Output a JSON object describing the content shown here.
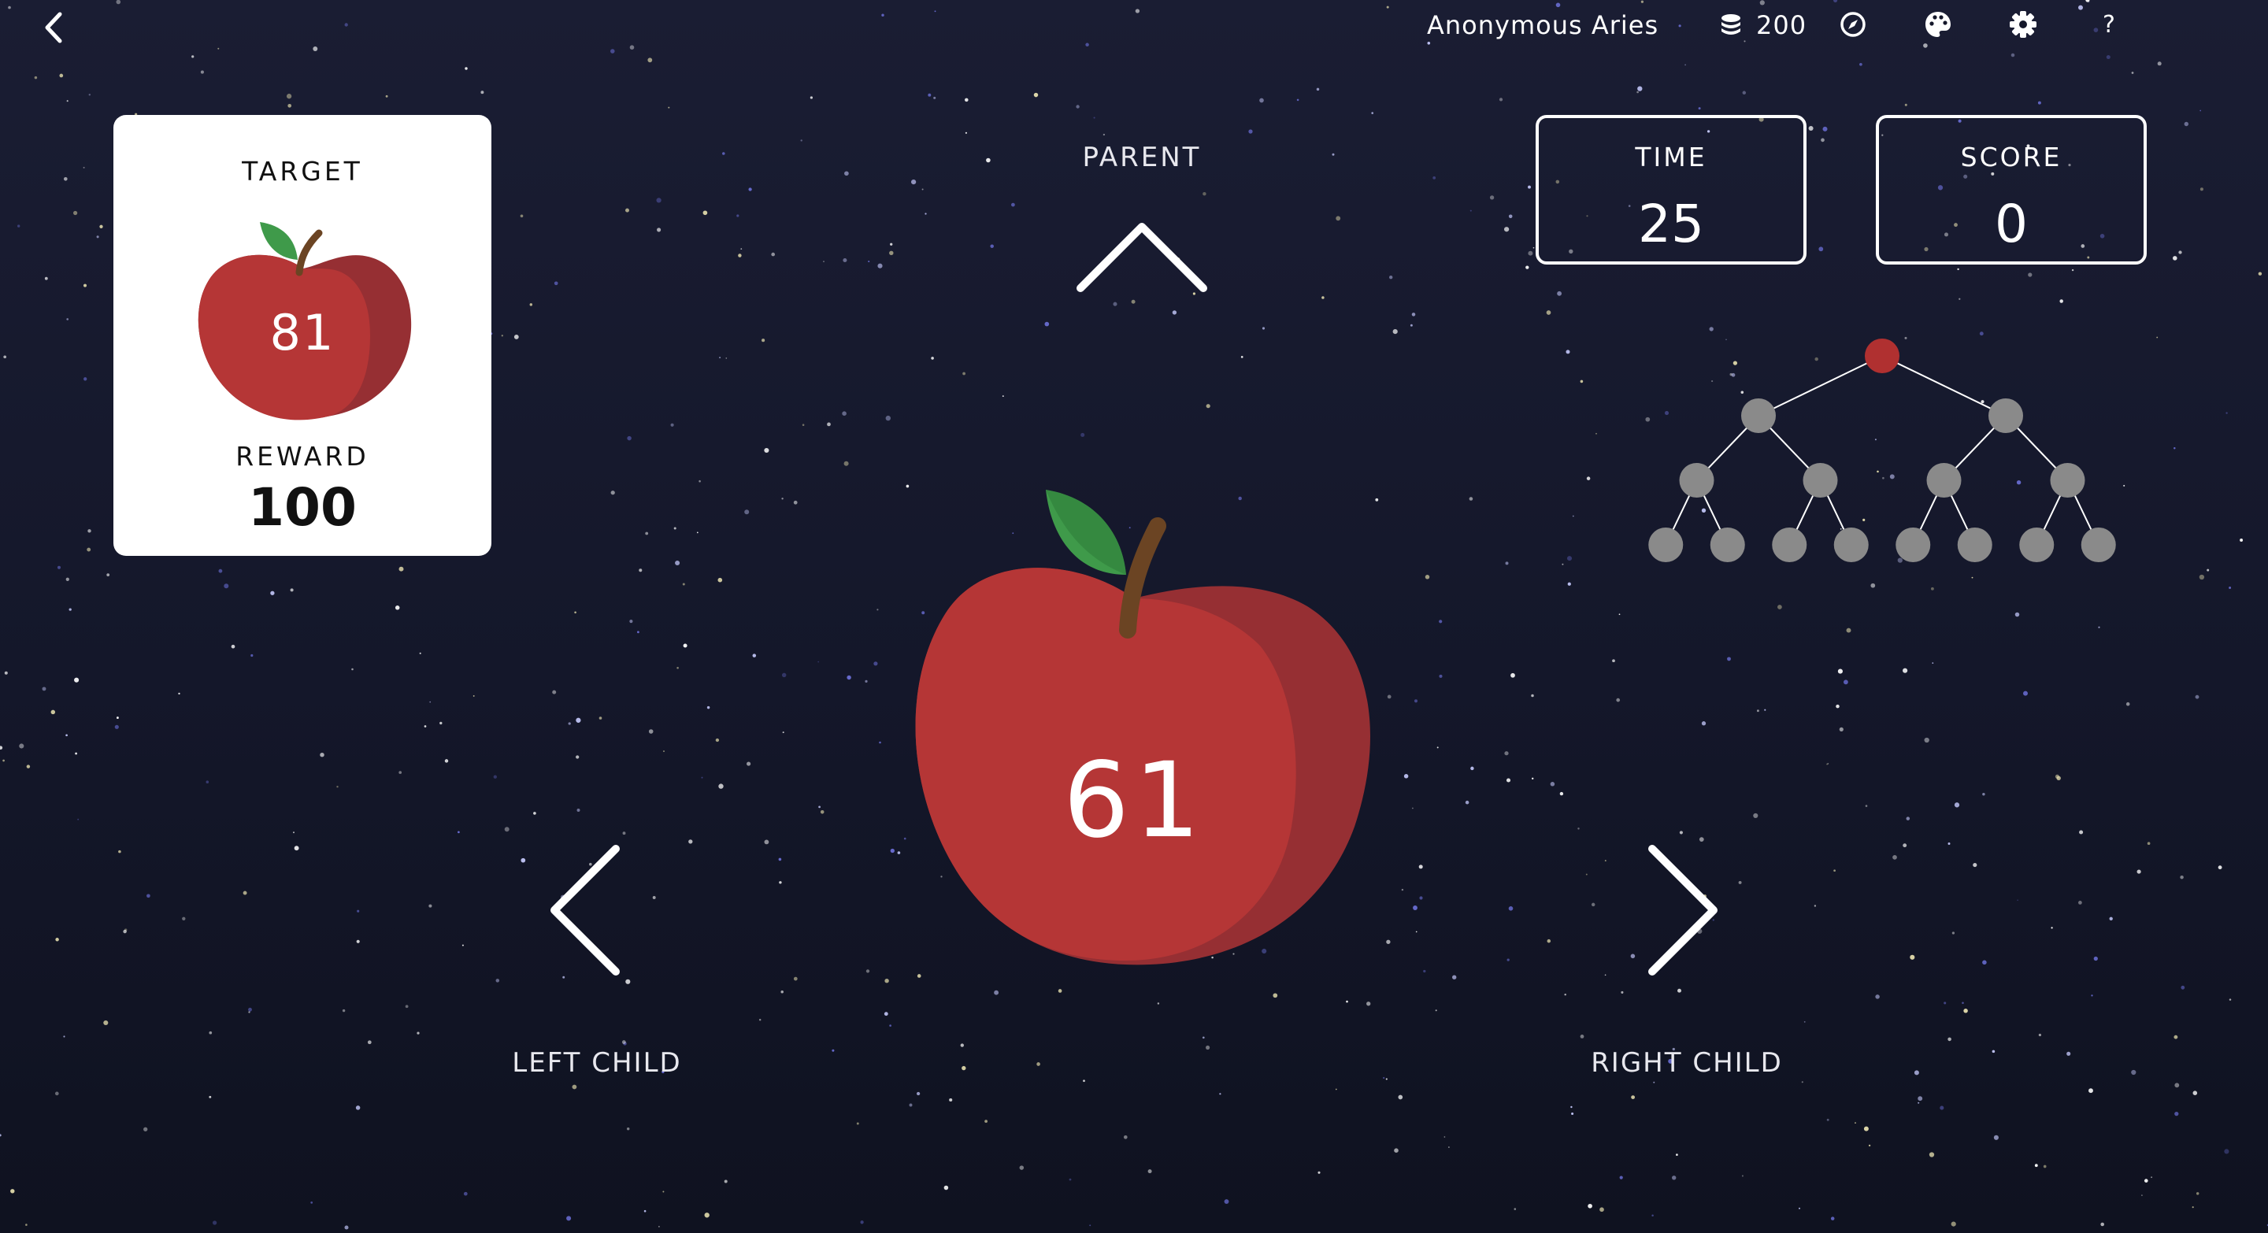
{
  "topbar": {
    "player_name": "Anonymous Aries",
    "coins": "200",
    "help_label": "?",
    "icons": [
      "back-icon",
      "coins-icon",
      "compass-icon",
      "palette-icon",
      "gear-icon"
    ]
  },
  "target_card": {
    "target_label": "TARGET",
    "target_value": "81",
    "reward_label": "REWARD",
    "reward_value": "100"
  },
  "navigation": {
    "parent_label": "PARENT",
    "left_child_label": "LEFT CHILD",
    "right_child_label": "RIGHT CHILD"
  },
  "stats": {
    "time_label": "TIME",
    "time_value": "25",
    "score_label": "SCORE",
    "score_value": "0"
  },
  "current_node": {
    "value": "61"
  },
  "tree_map": {
    "depth": 4,
    "current_position": "root",
    "active_color": "#b03030",
    "node_color": "#8a8a8a"
  },
  "colors": {
    "apple_red": "#b53636",
    "apple_shadow": "#962f33",
    "leaf_green": "#3f9a4a",
    "stem_brown": "#6b4423"
  }
}
